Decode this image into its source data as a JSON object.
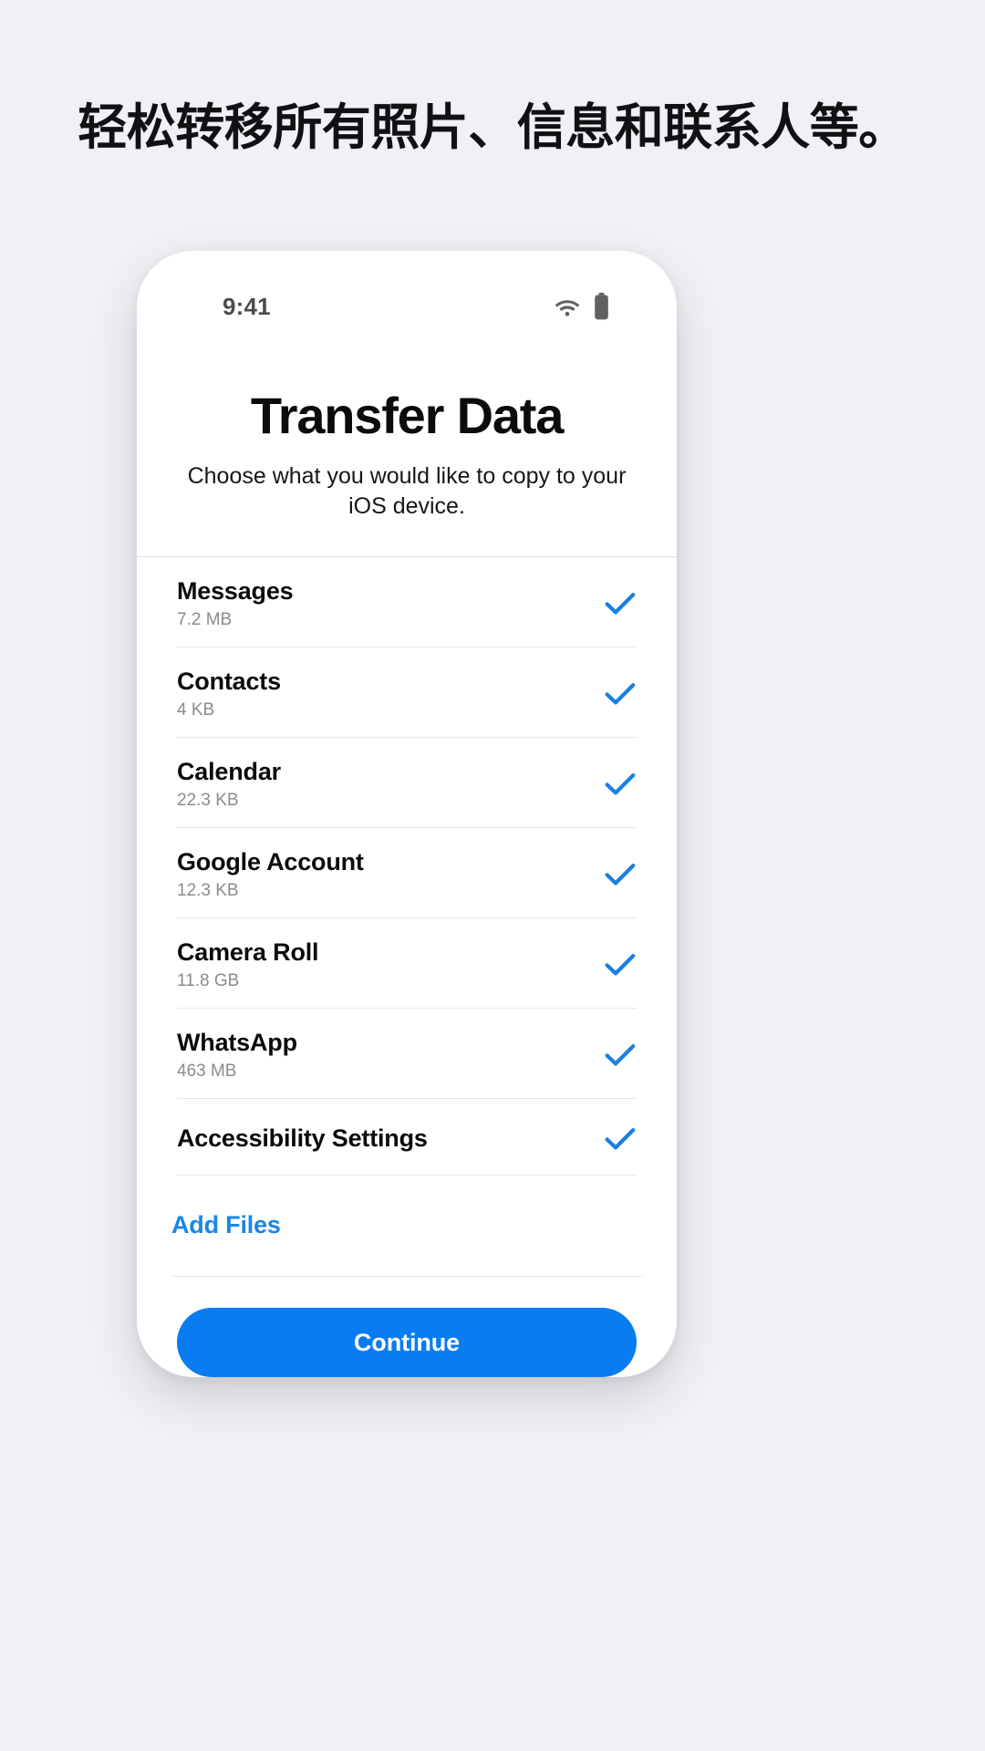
{
  "marketing": {
    "headline": "轻松转移所有照片、信息和联系人等。"
  },
  "colors": {
    "page_background": "#f1f1f5",
    "accent_blue": "#0a7cf1",
    "link_blue": "#1a86e8",
    "check_blue": "#1a7fe0",
    "title_text": "#0b0b0d",
    "secondary_text": "#8b8b90"
  },
  "phone": {
    "status_bar": {
      "time": "9:41",
      "wifi_icon": "wifi-icon",
      "battery_icon": "battery-icon"
    },
    "screen": {
      "title": "Transfer Data",
      "subtitle": "Choose what you would like to copy to your iOS device.",
      "items": [
        {
          "label": "Messages",
          "size": "7.2 MB",
          "selected": true,
          "check_icon": "check-icon"
        },
        {
          "label": "Contacts",
          "size": "4 KB",
          "selected": true,
          "check_icon": "check-icon"
        },
        {
          "label": "Calendar",
          "size": "22.3 KB",
          "selected": true,
          "check_icon": "check-icon"
        },
        {
          "label": "Google Account",
          "size": "12.3 KB",
          "selected": true,
          "check_icon": "check-icon"
        },
        {
          "label": "Camera Roll",
          "size": "11.8 GB",
          "selected": true,
          "check_icon": "check-icon"
        },
        {
          "label": "WhatsApp",
          "size": "463 MB",
          "selected": true,
          "check_icon": "check-icon"
        },
        {
          "label": "Accessibility Settings",
          "size": "",
          "selected": true,
          "check_icon": "check-icon"
        }
      ],
      "add_files_label": "Add Files",
      "continue_label": "Continue"
    }
  }
}
